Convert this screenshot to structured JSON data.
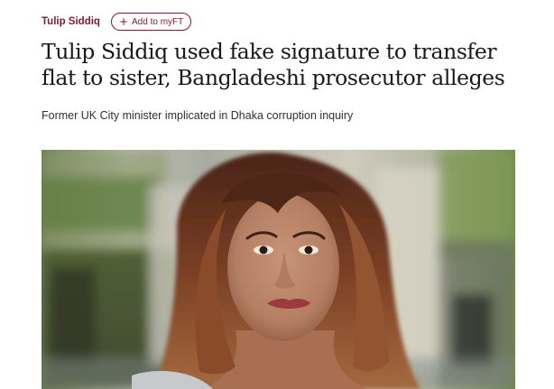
{
  "article": {
    "topic": "Tulip Siddiq",
    "add_button": {
      "plus_icon": "plus-icon",
      "label": "Add to myFT"
    },
    "headline": "Tulip Siddiq used fake signature to transfer flat to sister, Bangladeshi prosecutor alleges",
    "standfirst": "Former UK City minister implicated in Dhaka corruption inquiry",
    "image": {
      "subject": "photo-of-woman-with-long-auburn-hair-outdoors"
    }
  },
  "colors": {
    "brand_claret": "#7d1a34",
    "headline_text": "#1a1817",
    "body_text": "#33302e",
    "background": "#ffffff"
  }
}
